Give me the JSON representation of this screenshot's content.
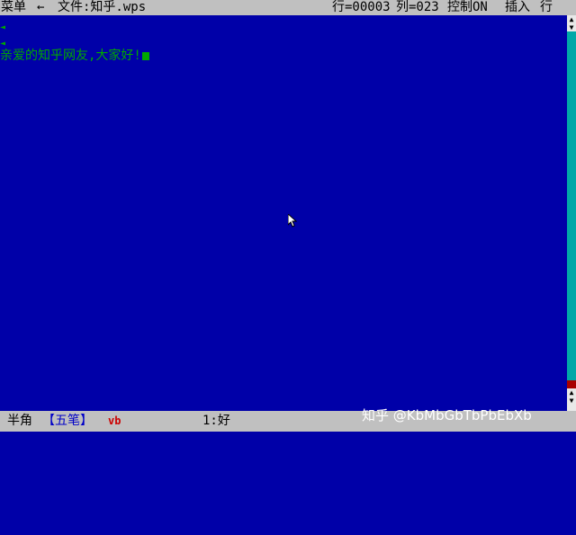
{
  "menu_bar": {
    "menu_label": "菜单",
    "arrow": "←",
    "file_label": "文件:知乎.wps",
    "row_info": "行=00003",
    "col_info": "列=023",
    "control_info": "控制ON",
    "insert_mode": "插入",
    "line_mode": "行"
  },
  "editor": {
    "marker_1": "◄",
    "marker_2": "◄",
    "text_line": "亲爱的知乎网友,大家好!"
  },
  "scrollbar": {
    "up_label": "▲\n▼",
    "down_label": "▲\n▼"
  },
  "status_bar": {
    "width_mode": "半角",
    "input_method": "【五笔】",
    "ime_code": "vb",
    "candidate": "1:好",
    "watermark": "知乎 @KbMbGbTbPbEbXb"
  },
  "colors": {
    "background": "#0000a8",
    "text": "#00a800",
    "bar": "#c0c0c0",
    "accent_red": "#cc0000",
    "ime_blue": "#0000c8"
  }
}
